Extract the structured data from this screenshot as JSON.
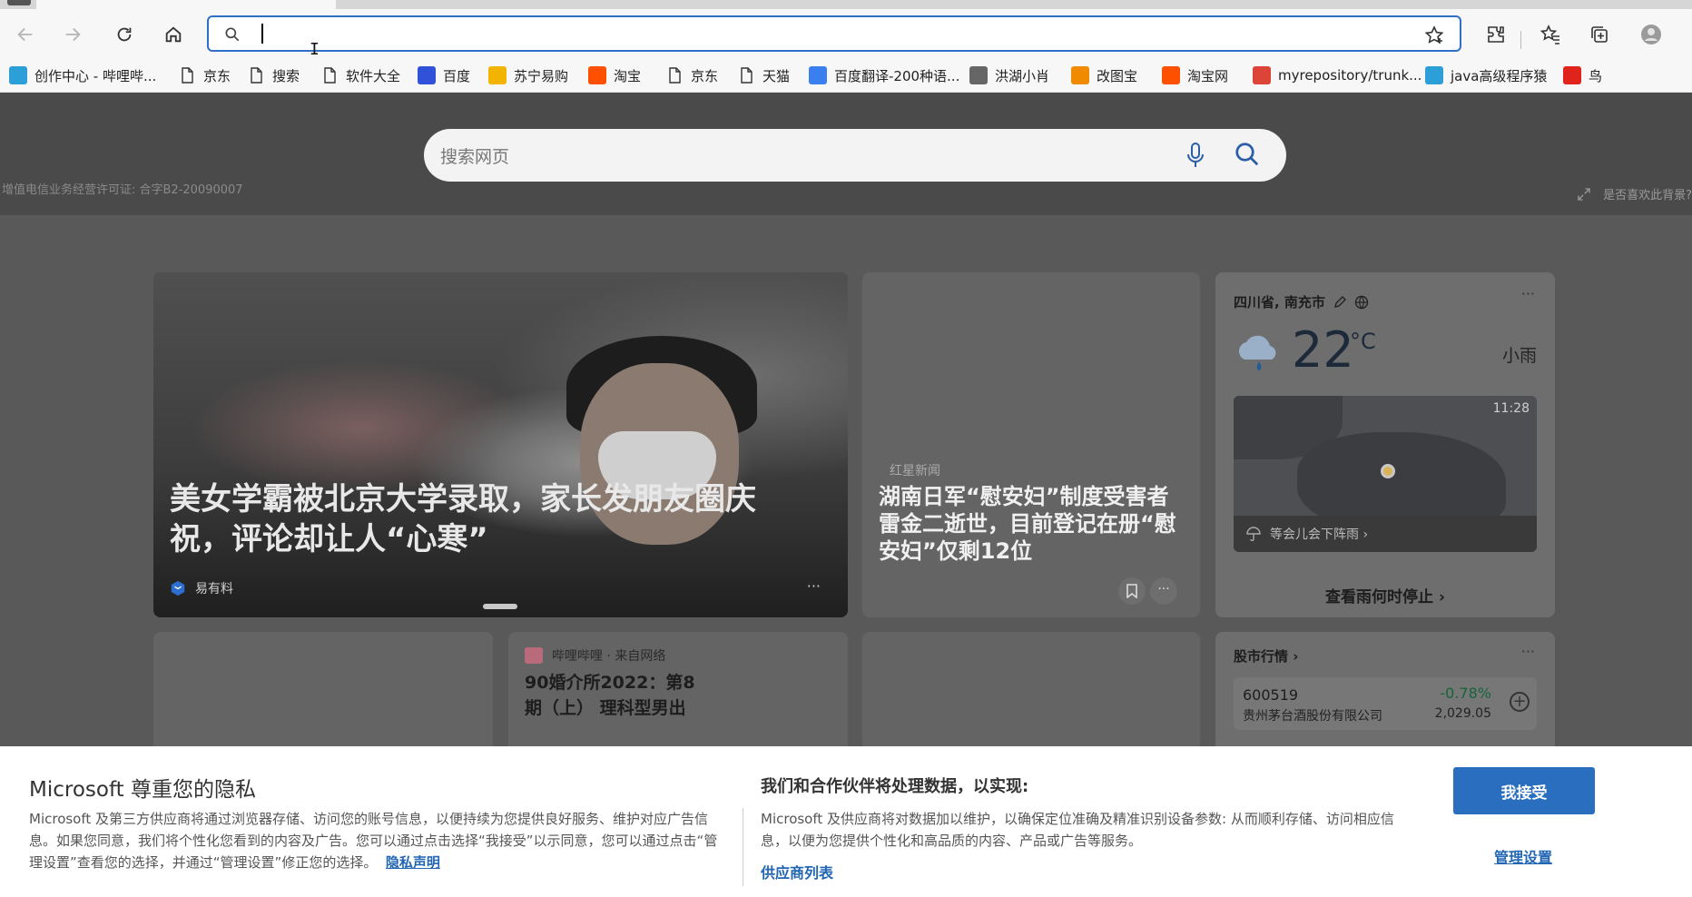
{
  "browser": {
    "address_value": "",
    "bookmarks": [
      {
        "label": "创作中心 - 哔哩哔...",
        "icon": "bilibili-icon",
        "color": "#2c9fd9"
      },
      {
        "label": "京东",
        "icon": "page-icon"
      },
      {
        "label": "搜索",
        "icon": "page-icon"
      },
      {
        "label": "软件大全",
        "icon": "page-icon"
      },
      {
        "label": "百度",
        "icon": "baidu-icon",
        "color": "#3152d8"
      },
      {
        "label": "苏宁易购",
        "icon": "suning-icon",
        "color": "#f2b400"
      },
      {
        "label": "淘宝",
        "icon": "taobao-icon",
        "color": "#ff5000"
      },
      {
        "label": "京东",
        "icon": "page-icon"
      },
      {
        "label": "天猫",
        "icon": "page-icon"
      },
      {
        "label": "百度翻译-200种语...",
        "icon": "baidu-translate-icon",
        "color": "#3a7ff0"
      },
      {
        "label": "洪湖小肖",
        "icon": "hongxiao-icon",
        "color": "#666666"
      },
      {
        "label": "改图宝",
        "icon": "gaitubao-icon",
        "color": "#f08a00"
      },
      {
        "label": "淘宝网",
        "icon": "taobao-icon",
        "color": "#ff5000"
      },
      {
        "label": "myrepository/trunk...",
        "icon": "chrome-icon",
        "color": "#db4437"
      },
      {
        "label": "java高级程序猿",
        "icon": "bilibili-icon",
        "color": "#2c9fd9"
      },
      {
        "label": "鸟",
        "icon": "bird-icon",
        "color": "#e0241b"
      }
    ]
  },
  "hero": {
    "search_placeholder": "搜索网页",
    "license": "增值电信业务经营许可证: 合字B2-20090007",
    "bg_prompt": "是否喜欢此背景?"
  },
  "feed": {
    "main": {
      "headline": "美女学霸被北京大学录取，家长发朋友圈庆祝，评论却让人“心寒”",
      "source": "易有料",
      "more": "···"
    },
    "news": {
      "outlet": "红星新闻",
      "title": "湖南日军“慰安妇”制度受害者雷金二逝世，目前登记在册“慰安妇”仅剩12位",
      "more": "···"
    },
    "weather": {
      "location": "四川省, 南充市",
      "temp": "22",
      "unit": "°C",
      "condition": "小雨",
      "map_time": "11:28",
      "rain_note": "等会儿会下阵雨 ›",
      "stop_link": "查看雨何时停止 ›",
      "more": "···"
    },
    "bilibili": {
      "outlet": "哔哩哔哩 · 来自网络",
      "title": "90婚介所2022：第8期（上） 理科型男出"
    },
    "stocks": {
      "header": "股市行情 ›",
      "more": "···",
      "code": "600519",
      "name": "贵州茅台酒股份有限公司",
      "change": "-0.78%",
      "price": "2,029.05",
      "add": "+"
    }
  },
  "consent": {
    "title": "Microsoft 尊重您的隐私",
    "body": "Microsoft 及第三方供应商将通过浏览器存储、访问您的账号信息，以便持续为您提供良好服务、维护对应广告信息。如果您同意，我们将个性化您看到的内容及广告。您可以通过点击选择“我接受”以示同意，您可以通过点击“管理设置”查看您的选择，并通过“管理设置”修正您的选择。",
    "privacy_link": "隐私声明",
    "heading2": "我们和合作伙伴将处理数据，以实现:",
    "body2": "Microsoft 及供应商将对数据加以维护，以确保定位准确及精准识别设备参数: 从而顺利存储、访问相应信息，以便为您提供个性化和高品质的内容、产品或广告等服务。",
    "vendors_link": "供应商列表",
    "accept": "我接受",
    "manage": "管理设置"
  },
  "colors": {
    "accent": "#2a6ec0",
    "address_border": "#2f6fc7",
    "stock_change": "#15653a"
  }
}
